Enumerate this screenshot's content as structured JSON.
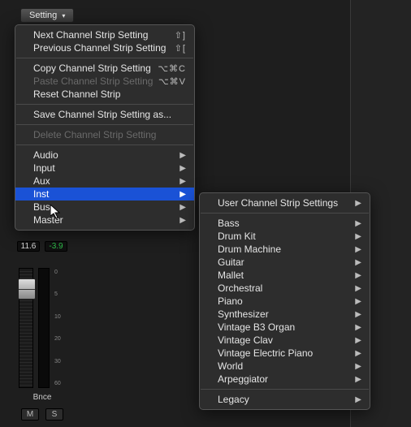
{
  "header": {
    "setting_label": "Setting"
  },
  "menu": {
    "next": "Next Channel Strip Setting",
    "prev": "Previous Channel Strip Setting",
    "copy": "Copy Channel Strip Setting",
    "paste": "Paste Channel Strip Setting",
    "reset": "Reset Channel Strip",
    "save_as": "Save Channel Strip Setting as...",
    "delete": "Delete Channel Strip Setting",
    "audio": "Audio",
    "input": "Input",
    "aux": "Aux",
    "inst": "Inst",
    "bus": "Bus",
    "master": "Master",
    "sc_next": "⇧]",
    "sc_prev": "⇧[",
    "sc_copy": "⌥⌘C",
    "sc_paste": "⌥⌘V"
  },
  "submenu": {
    "user": "User Channel Strip Settings",
    "bass": "Bass",
    "drum_kit": "Drum Kit",
    "drum_machine": "Drum Machine",
    "guitar": "Guitar",
    "mallet": "Mallet",
    "orchestral": "Orchestral",
    "piano": "Piano",
    "synthesizer": "Synthesizer",
    "vb3": "Vintage B3 Organ",
    "vclav": "Vintage Clav",
    "vep": "Vintage Electric Piano",
    "world": "World",
    "arp": "Arpeggiator",
    "legacy": "Legacy"
  },
  "strip": {
    "db": "11.6",
    "peak": "-3.9",
    "bnce": "Bnce",
    "mute": "M",
    "solo": "S",
    "ticks": [
      "0",
      "5",
      "10",
      "20",
      "30",
      "60"
    ]
  }
}
